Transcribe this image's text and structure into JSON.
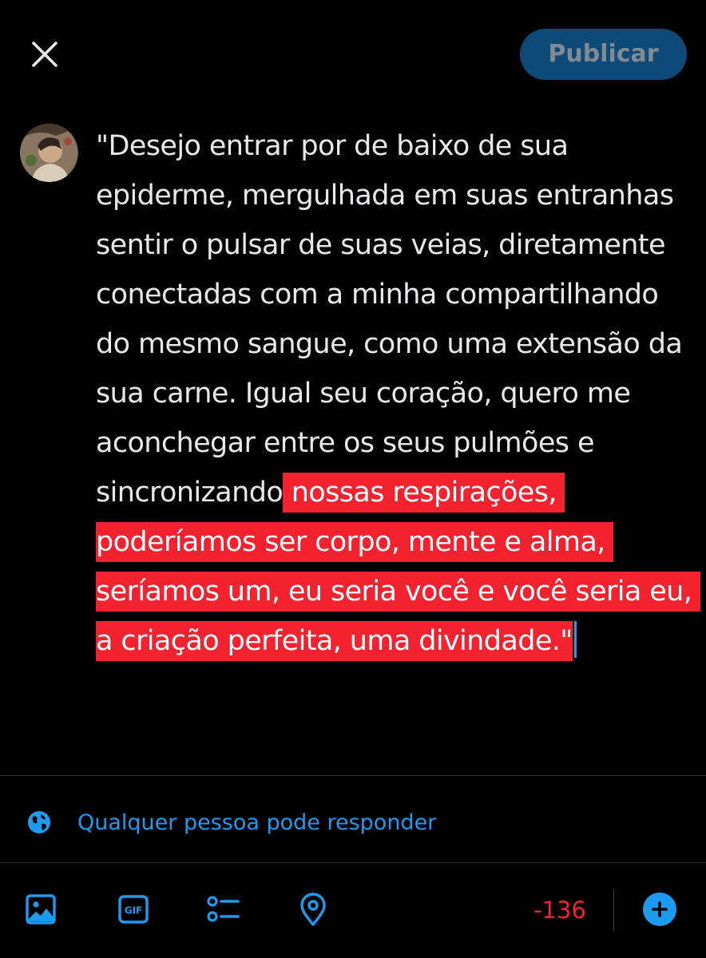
{
  "header": {
    "close_icon": "close-icon",
    "publish_label": "Publicar"
  },
  "composer": {
    "avatar_icon": "user-avatar",
    "text_normal": "\"Desejo entrar por de baixo de sua epiderme, mergulhada em suas entranhas sentir o pulsar de suas veias, diretamente conectadas com a minha compartilhando do mesmo sangue, como uma extensão da sua carne. Igual seu coração, quero me aconchegar entre os seus pulmões e sincronizando",
    "text_over_limit": " nossas respirações, poderíamos ser corpo, mente e alma, seríamos um, eu seria você e você seria eu, a criação perfeita, uma divindade.\"",
    "over_limit_color": "#f4212e"
  },
  "reply_setting": {
    "icon": "globe-icon",
    "label": "Qualquer pessoa pode responder"
  },
  "toolbar": {
    "icons": [
      "image-icon",
      "gif-icon",
      "poll-icon",
      "location-icon"
    ],
    "gif_label": "GIF",
    "char_count": "-136",
    "add_icon": "plus-icon"
  },
  "colors": {
    "accent": "#1d9bf0",
    "publish_bg": "#0d4a78",
    "error": "#f4212e",
    "text": "#e7e9ea",
    "background": "#000000"
  }
}
